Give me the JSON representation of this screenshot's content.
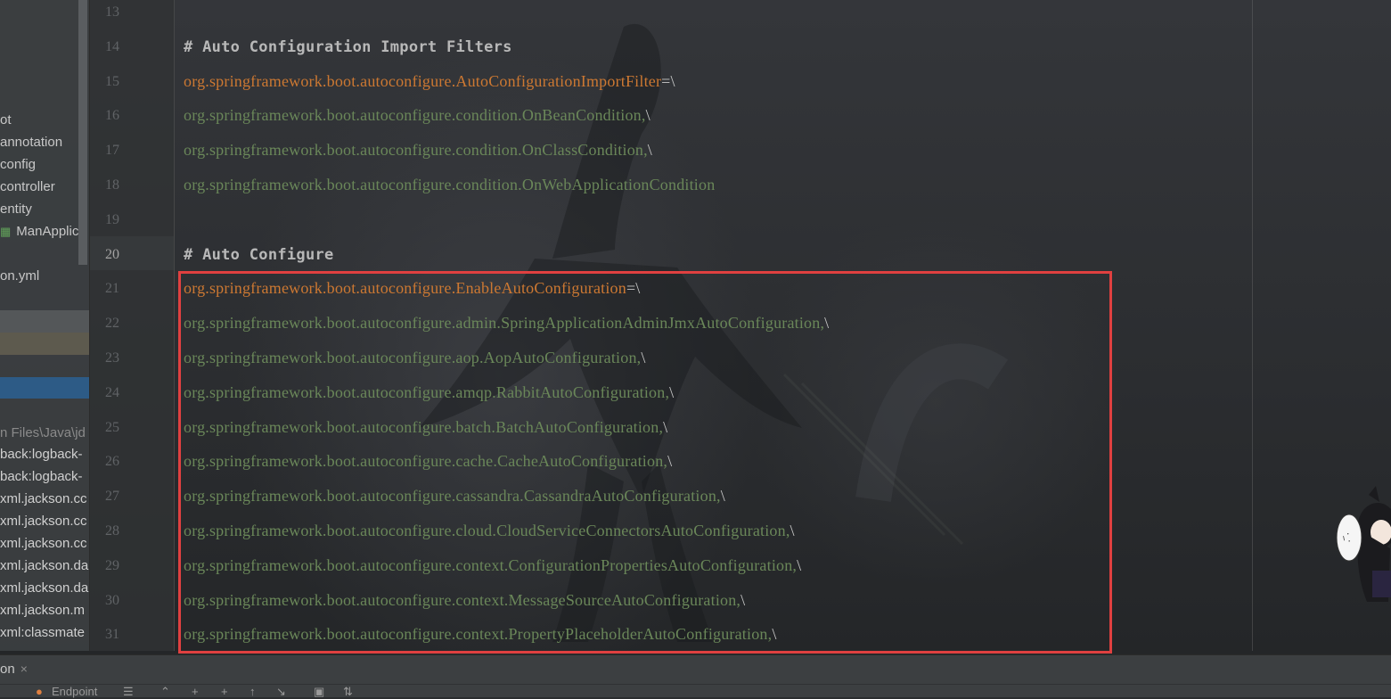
{
  "project_tree": {
    "items": [
      {
        "label": "ot"
      },
      {
        "label": "annotation"
      },
      {
        "label": "config"
      },
      {
        "label": "controller"
      },
      {
        "label": "entity"
      },
      {
        "label": "ManApplic",
        "icon": "spring-class-icon"
      },
      {
        "label": "on.yml"
      }
    ],
    "libraries": [
      {
        "label": "n Files\\Java\\jd"
      },
      {
        "label": "back:logback-"
      },
      {
        "label": "back:logback-"
      },
      {
        "label": "xml.jackson.cc"
      },
      {
        "label": "xml.jackson.cc"
      },
      {
        "label": "xml.jackson.cc"
      },
      {
        "label": "xml.jackson.da"
      },
      {
        "label": "xml.jackson.da"
      },
      {
        "label": "xml.jackson.m"
      },
      {
        "label": "xml:classmate"
      }
    ]
  },
  "editor": {
    "current_line": "20",
    "lines": [
      {
        "num": "13",
        "parts": []
      },
      {
        "num": "14",
        "parts": [
          {
            "t": "comment",
            "s": "# Auto Configuration Import Filters"
          }
        ]
      },
      {
        "num": "15",
        "parts": [
          {
            "t": "key",
            "s": "org.springframework.boot.autoconfigure.AutoConfigurationImportFilter"
          },
          {
            "t": "op",
            "s": "=\\"
          }
        ]
      },
      {
        "num": "16",
        "parts": [
          {
            "t": "val",
            "s": "org.springframework.boot.autoconfigure.condition.OnBeanCondition,"
          },
          {
            "t": "op",
            "s": "\\"
          }
        ]
      },
      {
        "num": "17",
        "parts": [
          {
            "t": "val",
            "s": "org.springframework.boot.autoconfigure.condition.OnClassCondition,"
          },
          {
            "t": "op",
            "s": "\\"
          }
        ]
      },
      {
        "num": "18",
        "parts": [
          {
            "t": "val",
            "s": "org.springframework.boot.autoconfigure.condition.OnWebApplicationCondition"
          }
        ]
      },
      {
        "num": "19",
        "parts": []
      },
      {
        "num": "20",
        "parts": [
          {
            "t": "comment",
            "s": "# Auto Configure"
          }
        ]
      },
      {
        "num": "21",
        "parts": [
          {
            "t": "key",
            "s": "org.springframework.boot.autoconfigure.EnableAutoConfiguration"
          },
          {
            "t": "op",
            "s": "=\\"
          }
        ]
      },
      {
        "num": "22",
        "parts": [
          {
            "t": "val",
            "s": "org.springframework.boot.autoconfigure.admin.SpringApplicationAdminJmxAutoConfiguration,"
          },
          {
            "t": "op",
            "s": "\\"
          }
        ]
      },
      {
        "num": "23",
        "parts": [
          {
            "t": "val",
            "s": "org.springframework.boot.autoconfigure.aop.AopAutoConfiguration,"
          },
          {
            "t": "op",
            "s": "\\"
          }
        ]
      },
      {
        "num": "24",
        "parts": [
          {
            "t": "val",
            "s": "org.springframework.boot.autoconfigure.amqp.RabbitAutoConfiguration,"
          },
          {
            "t": "op",
            "s": "\\"
          }
        ]
      },
      {
        "num": "25",
        "parts": [
          {
            "t": "val",
            "s": "org.springframework.boot.autoconfigure.batch.BatchAutoConfiguration,"
          },
          {
            "t": "op",
            "s": "\\"
          }
        ]
      },
      {
        "num": "26",
        "parts": [
          {
            "t": "val",
            "s": "org.springframework.boot.autoconfigure.cache.CacheAutoConfiguration,"
          },
          {
            "t": "op",
            "s": "\\"
          }
        ]
      },
      {
        "num": "27",
        "parts": [
          {
            "t": "val",
            "s": "org.springframework.boot.autoconfigure.cassandra.CassandraAutoConfiguration,"
          },
          {
            "t": "op",
            "s": "\\"
          }
        ]
      },
      {
        "num": "28",
        "parts": [
          {
            "t": "val",
            "s": "org.springframework.boot.autoconfigure.cloud.CloudServiceConnectorsAutoConfiguration,"
          },
          {
            "t": "op",
            "s": "\\"
          }
        ]
      },
      {
        "num": "29",
        "parts": [
          {
            "t": "val",
            "s": "org.springframework.boot.autoconfigure.context.ConfigurationPropertiesAutoConfiguration,"
          },
          {
            "t": "op",
            "s": "\\"
          }
        ]
      },
      {
        "num": "30",
        "parts": [
          {
            "t": "val",
            "s": "org.springframework.boot.autoconfigure.context.MessageSourceAutoConfiguration,"
          },
          {
            "t": "op",
            "s": "\\"
          }
        ]
      },
      {
        "num": "31",
        "parts": [
          {
            "t": "val",
            "s": "org.springframework.boot.autoconfigure.context.PropertyPlaceholderAutoConfiguration,"
          },
          {
            "t": "op",
            "s": "\\"
          }
        ]
      }
    ]
  },
  "bottom": {
    "tab_label": "on",
    "close_glyph": "×",
    "toolbar_text": "Endpoint"
  },
  "colors": {
    "key": "#cc7832",
    "value": "#6a8759",
    "highlight_border": "#e04040"
  }
}
